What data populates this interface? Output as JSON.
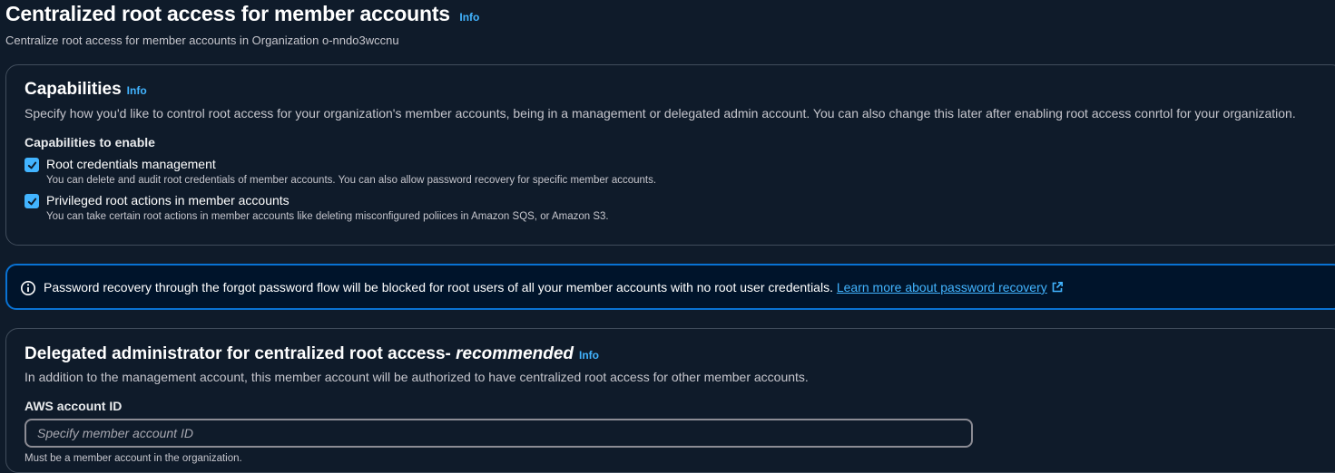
{
  "header": {
    "title": "Centralized root access for member accounts",
    "info": "Info",
    "description": "Centralize root access for member accounts in Organization o-nndo3wccnu"
  },
  "capabilities": {
    "title": "Capabilities",
    "info": "Info",
    "description": "Specify how you'd like to control root access for your organization's member accounts, being in a management or delegated admin account. You can also change this later after enabling root access conrtol for your organization.",
    "enable_label": "Capabilities to enable",
    "options": [
      {
        "label": "Root credentials management",
        "description": "You can delete and audit root credentials of member accounts. You can also allow password recovery for specific member accounts.",
        "checked": true
      },
      {
        "label": "Privileged root actions in member accounts",
        "description": "You can take certain root actions in member accounts like deleting misconfigured poliices in Amazon SQS, or Amazon S3.",
        "checked": true
      }
    ]
  },
  "alert": {
    "text": "Password recovery through the forgot password flow will be blocked for root users of all your member accounts with no root user credentials.",
    "link": "Learn more about password recovery",
    "icon": "info-circle-icon"
  },
  "delegated": {
    "title": "Delegated administrator for centralized root access- ",
    "title_emphasis": "recommended",
    "info": "Info",
    "description": "In addition to the management account, this member account will be authorized to have centralized root access for other member accounts.",
    "field_label": "AWS account ID",
    "placeholder": "Specify member account ID",
    "hint": "Must be a member account in the organization."
  },
  "colors": {
    "background": "#0f1b2a",
    "accent": "#42b4ff",
    "alert_border": "#0972d3"
  }
}
